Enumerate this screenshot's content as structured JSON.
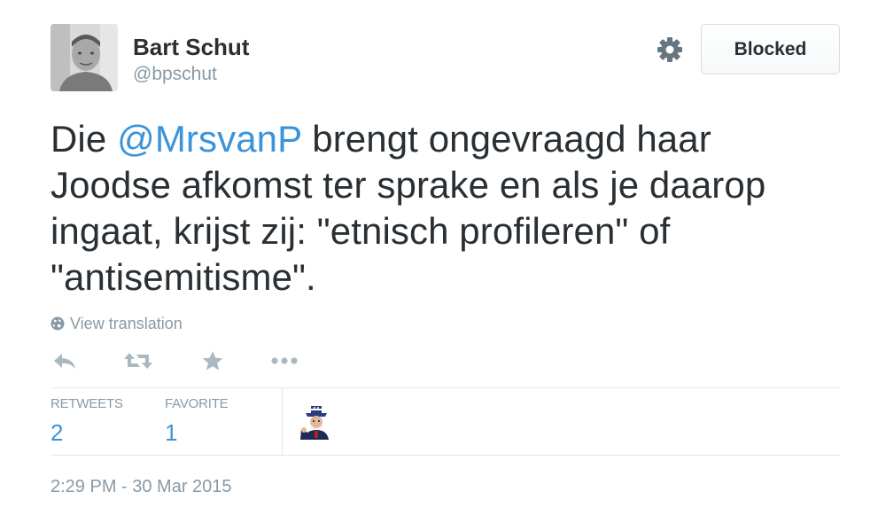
{
  "user": {
    "name": "Bart Schut",
    "handle": "@bpschut"
  },
  "header": {
    "blocked_label": "Blocked",
    "settings_icon": "gear-icon"
  },
  "tweet": {
    "lines": [
      {
        "mention": "@MrsvanP",
        "prefix": "Die ",
        "suffix": " brengt ongevraagd haar"
      },
      {
        "text": "Joodse afkomst ter sprake en als je daarop"
      },
      {
        "text": "ingaat, krijst zij: \"etnisch profileren\" of"
      },
      {
        "text": "\"antisemitisme\"."
      }
    ]
  },
  "translation": {
    "label": "View translation",
    "icon": "globe-icon"
  },
  "actions": {
    "reply_icon": "reply-icon",
    "retweet_icon": "retweet-icon",
    "favorite_icon": "star-icon",
    "more_icon": "more-icon"
  },
  "stats": {
    "retweets_label": "RETWEETS",
    "retweets_count": "2",
    "favorites_label": "FAVORITE",
    "favorites_count": "1"
  },
  "timestamp": "2:29 PM - 30 Mar 2015",
  "colors": {
    "link": "#3b94d9",
    "muted": "#8899a6",
    "text": "#292f33",
    "border": "#e1e8ed"
  }
}
